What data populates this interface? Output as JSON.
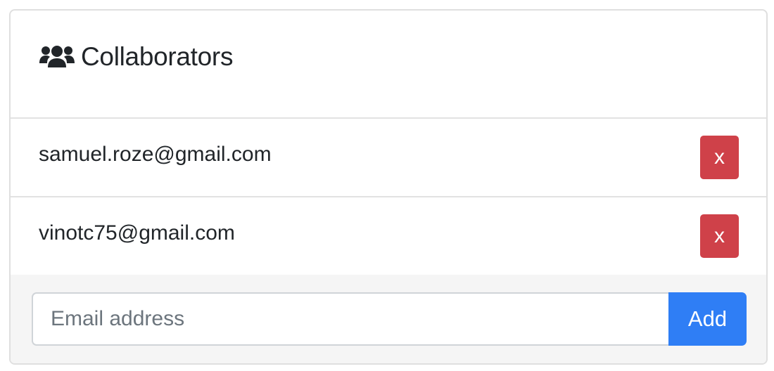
{
  "header": {
    "title": "Collaborators",
    "icon": "users-icon"
  },
  "collaborators": [
    {
      "email": "samuel.roze@gmail.com",
      "remove_label": "x"
    },
    {
      "email": "vinotc75@gmail.com",
      "remove_label": "x"
    }
  ],
  "footer": {
    "email_input": {
      "value": "",
      "placeholder": "Email address"
    },
    "add_label": "Add"
  },
  "colors": {
    "danger": "#cf4149",
    "primary": "#2f7ef5",
    "footer_bg": "#f5f5f5",
    "text": "#212529"
  }
}
